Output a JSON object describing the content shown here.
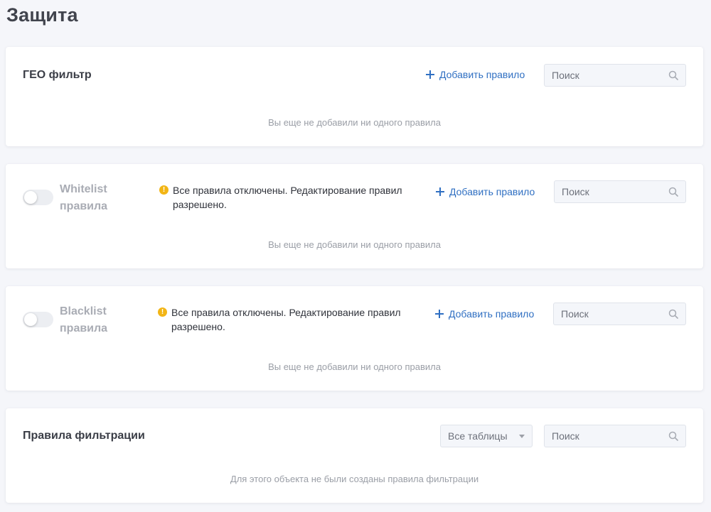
{
  "page": {
    "title": "Защита"
  },
  "geo": {
    "title": "ГЕО фильтр",
    "add_label": "Добавить правило",
    "search_placeholder": "Поиск",
    "empty": "Вы еще не добавили ни одного правила"
  },
  "whitelist": {
    "title": "Whitelist правила",
    "enabled": false,
    "notice": "Все правила отключены. Редактирование правил разрешено.",
    "add_label": "Добавить правило",
    "search_placeholder": "Поиск",
    "empty": "Вы еще не добавили ни одного правила"
  },
  "blacklist": {
    "title": "Blacklist правила",
    "enabled": false,
    "notice": "Все правила отключены. Редактирование правил разрешено.",
    "add_label": "Добавить правило",
    "search_placeholder": "Поиск",
    "empty": "Вы еще не добавили ни одного правила"
  },
  "filtering": {
    "title": "Правила фильтрации",
    "select_value": "Все таблицы",
    "search_placeholder": "Поиск",
    "empty": "Для этого объекта не были созданы правила фильтрации"
  },
  "icons": {
    "add": "plus-icon",
    "search": "search-icon",
    "info": "info-icon",
    "dropdown": "caret-down-icon"
  },
  "colors": {
    "accent": "#2f6fc2",
    "warning": "#f2b515",
    "background": "#f5f6fa"
  }
}
